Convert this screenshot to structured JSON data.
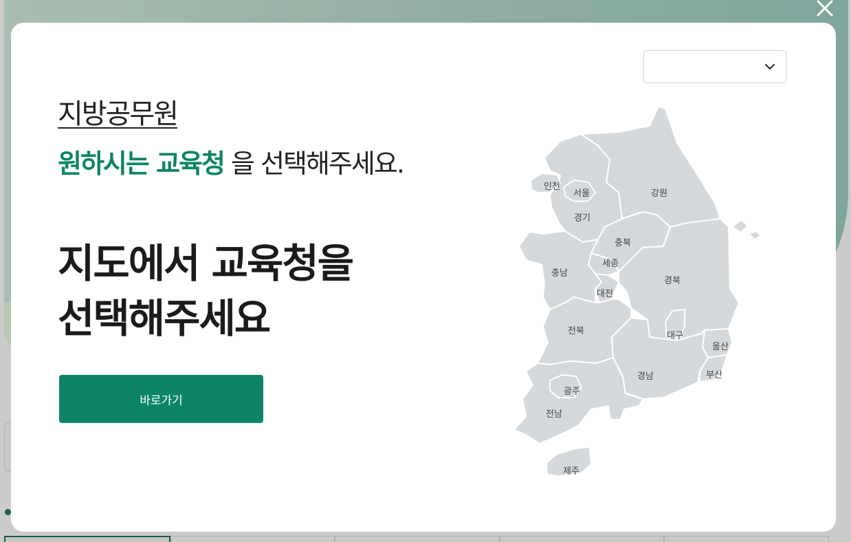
{
  "modal": {
    "subtitle": "지방공무원",
    "instruction_accent": "원하시는 교육청",
    "instruction_rest": " 을 선택해주세요.",
    "headline_line1": "지도에서 교육청을",
    "headline_line2": "선택해주세요",
    "go_button_label": "바로가기",
    "select_value": ""
  },
  "map_regions": {
    "incheon": "인천",
    "seoul": "서울",
    "gyeonggi": "경기",
    "gangwon": "강원",
    "chungbuk": "충북",
    "sejong": "세종",
    "chungnam": "충남",
    "daejeon": "대전",
    "gyeongbuk": "경북",
    "jeonbuk": "전북",
    "daegu": "대구",
    "ulsan": "울산",
    "gyeongnam": "경남",
    "busan": "부산",
    "gwangju": "광주",
    "jeonnam": "전남",
    "jeju": "제주"
  },
  "colors": {
    "accent": "#0b8566",
    "map_fill": "#d5d9dc",
    "headline": "#1b1b1b"
  }
}
